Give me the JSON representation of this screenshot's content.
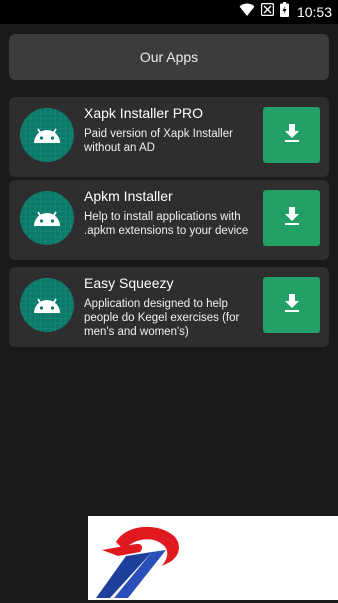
{
  "status_bar": {
    "time": "10:53"
  },
  "header": {
    "title": "Our Apps"
  },
  "apps": [
    {
      "title": "Xapk Installer PRO",
      "description": "Paid version of Xapk Installer without an AD"
    },
    {
      "title": "Apkm Installer",
      "description": "Help to install applications with .apkm extensions to your device"
    },
    {
      "title": "Easy Squeezy",
      "description": "Application designed to help people do Kegel exercises (for men's and women's)"
    }
  ],
  "colors": {
    "background": "#191919",
    "card": "#2e2e2e",
    "header_card": "#3c3c3c",
    "download_button": "#22a065",
    "icon_background": "#0b7a6a"
  },
  "icons": {
    "app_icon": "android-icon",
    "download": "download-icon",
    "wifi": "wifi-icon",
    "notification": "notification-icon",
    "battery": "battery-charging-icon"
  }
}
